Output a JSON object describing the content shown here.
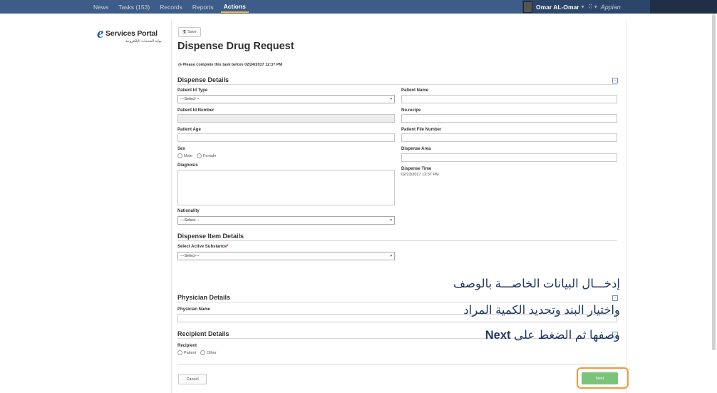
{
  "topbar": {
    "nav": [
      "News",
      "Tasks (153)",
      "Records",
      "Reports"
    ],
    "active": "Actions",
    "user_name": "Omar AL-Omar",
    "user_caret": "▾",
    "apps_icon": "⠿ ▾",
    "brand": "Appian"
  },
  "logo": {
    "name": "Services Portal",
    "letter": "e",
    "subtitle": "بوابة الخدمات الإلكترونية"
  },
  "form": {
    "save_label": "Save",
    "title": "Dispense Drug Request",
    "due_text": "Please complete this task before 02/24/2017 12:37 PM",
    "sections": {
      "dispense_details": "Dispense Details",
      "item_details": "Dispense Item Details",
      "physician": "Physician Details",
      "recipient": "Recipient Details"
    },
    "labels": {
      "patient_id_type": "Patient Id Type",
      "patient_id_number": "Patient Id Number",
      "patient_age": "Patient Age",
      "sex": "Sex",
      "diagnosis": "Diagnosis",
      "nationality": "Nationality",
      "patient_name": "Patient Name",
      "no_recipe": "No.recipe",
      "patient_file_number": "Patient File Number",
      "dispense_area": "Dispense Area",
      "dispense_time": "Dispense Time",
      "active_substance": "Select Active Substance",
      "physician_name": "Physician Name",
      "recipient": "Recipient"
    },
    "select_placeholder": "---Select---",
    "sex_options": [
      "Male",
      "Female"
    ],
    "recipient_options": [
      "Patient",
      "Other"
    ],
    "dispense_time_value": "02/23/2017 12:37 PM",
    "required_mark": "*",
    "cancel_label": "Cancel",
    "next_label": "Next"
  },
  "overlay": {
    "line1": "إدخـــال البيانات الخاصـــة بالوصف",
    "line2": "واختيار البند وتحديد الكمية المراد",
    "line3_prefix": "وصفها ثم الضغط على",
    "line3_bold": "Next"
  },
  "colors": {
    "topbar": "#3d5c87",
    "accent": "#f2b640",
    "next_button": "#7ac47a",
    "highlight": "#f39a3a",
    "overlay_text": "#1f3864"
  }
}
